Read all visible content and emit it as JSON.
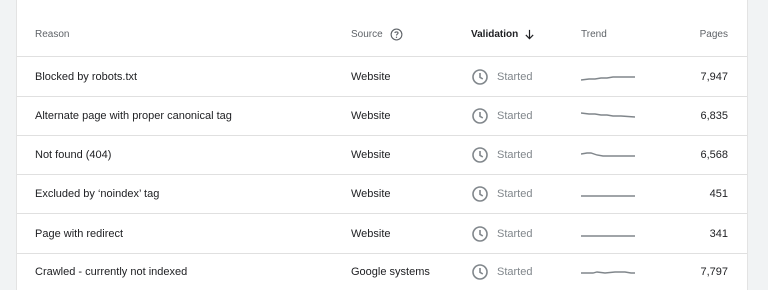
{
  "table": {
    "columns": {
      "reason": "Reason",
      "source": "Source",
      "validation": "Validation",
      "trend": "Trend",
      "pages": "Pages"
    },
    "rows": [
      {
        "reason": "Blocked by robots.txt",
        "source": "Website",
        "validation": "Started",
        "pages": "7,947"
      },
      {
        "reason": "Alternate page with proper canonical tag",
        "source": "Website",
        "validation": "Started",
        "pages": "6,835"
      },
      {
        "reason": "Not found (404)",
        "source": "Website",
        "validation": "Started",
        "pages": "6,568"
      },
      {
        "reason": "Excluded by ‘noindex’ tag",
        "source": "Website",
        "validation": "Started",
        "pages": "451"
      },
      {
        "reason": "Page with redirect",
        "source": "Website",
        "validation": "Started",
        "pages": "341"
      },
      {
        "reason": "Crawled - currently not indexed",
        "source": "Google systems",
        "validation": "Started",
        "pages": "7,797"
      }
    ]
  },
  "icons": {
    "source_help": "help-circle-icon",
    "sort": "arrow-down-icon",
    "status": "clock-icon",
    "cursor": "mouse-pointer-icon"
  },
  "colors": {
    "header_text": "#5f6368",
    "status_text": "#80868b",
    "trend_line": "#80868b"
  }
}
